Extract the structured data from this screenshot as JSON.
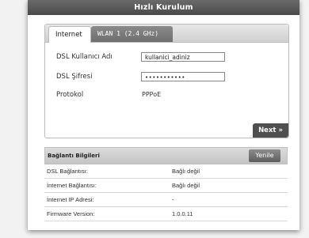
{
  "window": {
    "title": "Hızlı Kurulum"
  },
  "tabs": [
    {
      "label": "Internet"
    },
    {
      "label": "WLAN 1 (2.4 GHz)"
    }
  ],
  "form": {
    "dsl_user_label": "DSL Kullanıcı Adı",
    "dsl_user_value": "kullanici_adiniz",
    "dsl_pass_label": "DSL Şifresi",
    "dsl_pass_value": "•••••••••••",
    "protocol_label": "Protokol",
    "protocol_value": "PPPoE"
  },
  "buttons": {
    "next": "Next »",
    "refresh": "Yenile"
  },
  "connection_info": {
    "title": "Bağlantı Bilgileri",
    "rows": [
      {
        "label": "DSL Bağlantısı:",
        "value": "Bağlı değil"
      },
      {
        "label": "İnternet Bağlantısı:",
        "value": "Bağlı değil"
      },
      {
        "label": "İnternet IP Adresi:",
        "value": "-"
      },
      {
        "label": "Firmware Version:",
        "value": "1.0.0.11"
      }
    ]
  }
}
